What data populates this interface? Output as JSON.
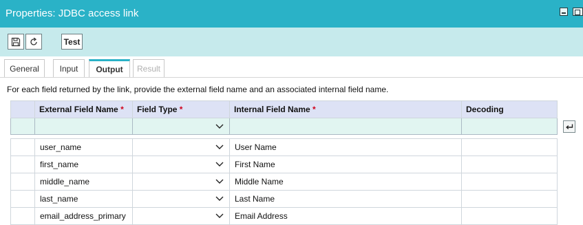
{
  "window": {
    "title": "Properties: JDBC access link"
  },
  "toolbar": {
    "save_icon": "save-icon",
    "refresh_icon": "refresh-icon",
    "test_label": "Test"
  },
  "tabs": [
    {
      "label": "General",
      "state": "normal"
    },
    {
      "label": "Input",
      "state": "normal"
    },
    {
      "label": "Output",
      "state": "active"
    },
    {
      "label": "Result",
      "state": "disabled"
    }
  ],
  "instructions": "For each field returned by the link, provide the external field name and an associated internal field name.",
  "grid": {
    "columns": [
      {
        "label": "External Field Name",
        "required": "*"
      },
      {
        "label": "Field Type",
        "required": "*"
      },
      {
        "label": "Internal Field Name",
        "required": "*"
      },
      {
        "label": "Decoding",
        "required": ""
      }
    ],
    "rows": [
      {
        "external": "user_name",
        "type": "",
        "internal": "User Name",
        "decoding": ""
      },
      {
        "external": "first_name",
        "type": "",
        "internal": "First Name",
        "decoding": ""
      },
      {
        "external": "middle_name",
        "type": "",
        "internal": "Middle Name",
        "decoding": ""
      },
      {
        "external": "last_name",
        "type": "",
        "internal": "Last Name",
        "decoding": ""
      },
      {
        "external": "email_address_primary",
        "type": "",
        "internal": "Email Address",
        "decoding": ""
      }
    ]
  },
  "colors": {
    "titlebar": "#2ab2c7",
    "toolbar": "#c6eaec",
    "header": "#dde2f5",
    "new_row": "#e1f5f1",
    "required": "#d0021b"
  }
}
